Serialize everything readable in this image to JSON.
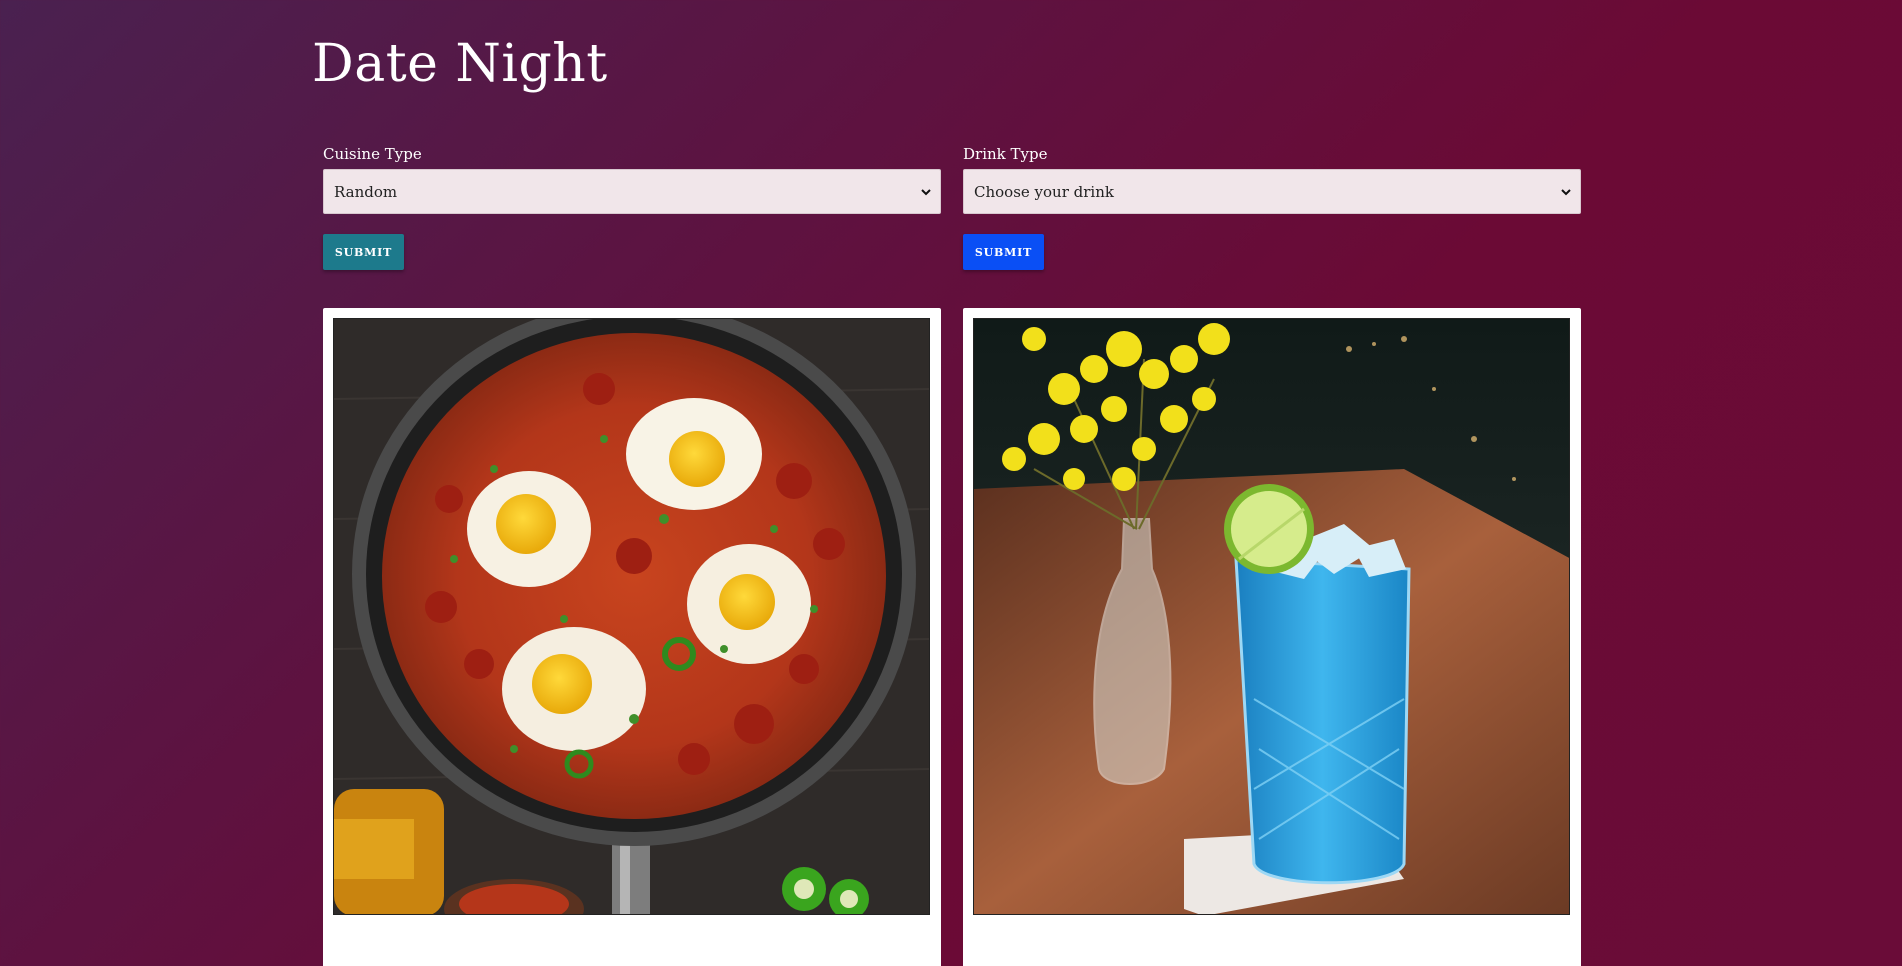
{
  "page": {
    "title": "Date Night"
  },
  "cuisine": {
    "label": "Cuisine Type",
    "selected": "Random",
    "submit_label": "SUBMIT",
    "button_color": "#1d7a8c",
    "image_alt": "Shakshuka with eggs in a skillet"
  },
  "drink": {
    "label": "Drink Type",
    "selected": "Choose your drink",
    "submit_label": "SUBMIT",
    "button_color": "#0a4ff5",
    "image_alt": "Blue cocktail with lime beside vase of yellow flowers"
  },
  "icons": {
    "select_arrow": "chevron-down-icon"
  }
}
